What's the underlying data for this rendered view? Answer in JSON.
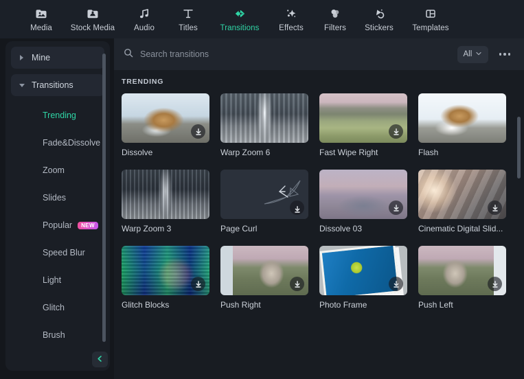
{
  "topnav": {
    "items": [
      {
        "label": "Media",
        "icon": "media-icon",
        "active": false
      },
      {
        "label": "Stock Media",
        "icon": "stock-media-icon",
        "active": false
      },
      {
        "label": "Audio",
        "icon": "audio-icon",
        "active": false
      },
      {
        "label": "Titles",
        "icon": "titles-icon",
        "active": false
      },
      {
        "label": "Transitions",
        "icon": "transitions-icon",
        "active": true
      },
      {
        "label": "Effects",
        "icon": "effects-icon",
        "active": false
      },
      {
        "label": "Filters",
        "icon": "filters-icon",
        "active": false
      },
      {
        "label": "Stickers",
        "icon": "stickers-icon",
        "active": false
      },
      {
        "label": "Templates",
        "icon": "templates-icon",
        "active": false
      }
    ]
  },
  "sidebar": {
    "groups": [
      {
        "label": "Mine",
        "expanded": false
      },
      {
        "label": "Transitions",
        "expanded": true
      }
    ],
    "items": [
      {
        "label": "Trending",
        "active": true,
        "badge": ""
      },
      {
        "label": "Fade&Dissolve",
        "active": false,
        "badge": ""
      },
      {
        "label": "Zoom",
        "active": false,
        "badge": ""
      },
      {
        "label": "Slides",
        "active": false,
        "badge": ""
      },
      {
        "label": "Popular",
        "active": false,
        "badge": "NEW"
      },
      {
        "label": "Speed Blur",
        "active": false,
        "badge": ""
      },
      {
        "label": "Light",
        "active": false,
        "badge": ""
      },
      {
        "label": "Glitch",
        "active": false,
        "badge": ""
      },
      {
        "label": "Brush",
        "active": false,
        "badge": ""
      }
    ],
    "collapse_icon": "chevron-left-icon"
  },
  "search": {
    "icon": "search-icon",
    "placeholder": "Search transitions",
    "value": "",
    "filter_label": "All",
    "filter_icon": "chevron-down-icon",
    "more_icon": "more-options-icon"
  },
  "content": {
    "section_title": "TRENDING",
    "cards": [
      {
        "label": "Dissolve",
        "art": "t-snow",
        "download": true
      },
      {
        "label": "Warp Zoom 6",
        "art": "t-city",
        "download": false
      },
      {
        "label": "Fast Wipe Right",
        "art": "t-field",
        "download": true
      },
      {
        "label": "Flash",
        "art": "t-snow2",
        "download": false
      },
      {
        "label": "Warp Zoom 3",
        "art": "t-city2",
        "download": false
      },
      {
        "label": "Page Curl",
        "art": "t-curl",
        "download": true
      },
      {
        "label": "Dissolve 03",
        "art": "t-mtn",
        "download": true
      },
      {
        "label": "Cinematic Digital Slid...",
        "art": "t-cine",
        "download": true
      },
      {
        "label": "Glitch Blocks",
        "art": "t-glitch",
        "download": true
      },
      {
        "label": "Push Right",
        "art": "t-house",
        "download": true
      },
      {
        "label": "Photo Frame",
        "art": "t-photo",
        "download": true
      },
      {
        "label": "Push Left",
        "art": "t-house2",
        "download": true
      }
    ]
  },
  "colors": {
    "accent": "#2fd6a6",
    "topnav_bg": "#1b2028",
    "sidebar_bg": "#1a1e25",
    "main_bg": "#181c22",
    "badge_new_start": "#f2509b",
    "badge_new_end": "#c558f0"
  }
}
